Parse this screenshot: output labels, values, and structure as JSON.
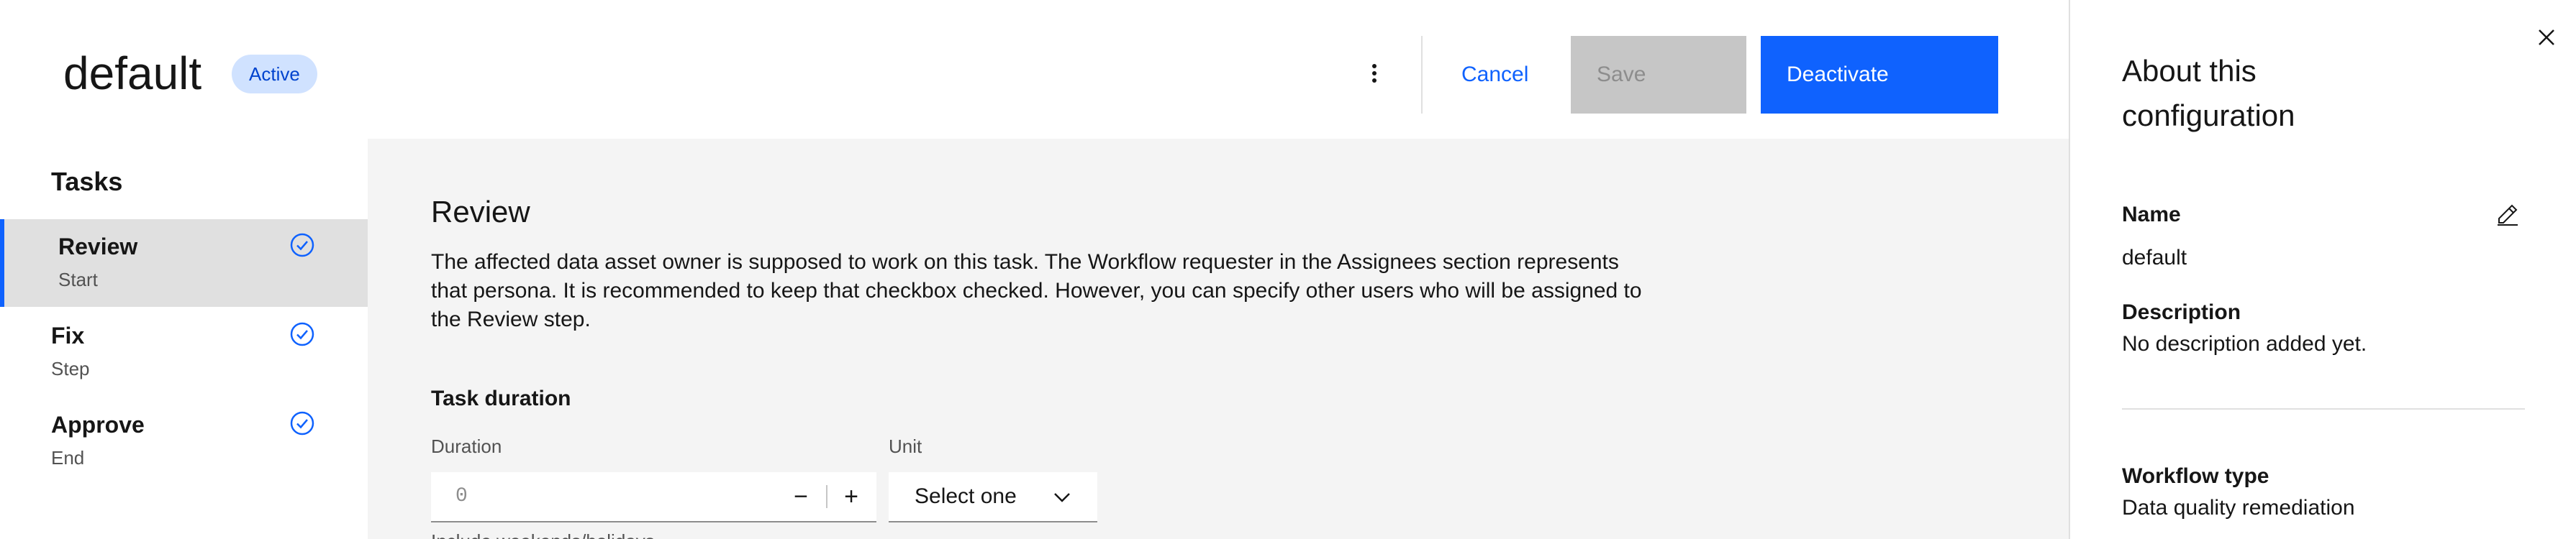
{
  "header": {
    "title": "default",
    "status_badge": "Active",
    "overflow_icon": "overflow-menu-vertical-icon",
    "cancel_label": "Cancel",
    "save_label": "Save",
    "deactivate_label": "Deactivate"
  },
  "sidebar": {
    "heading": "Tasks",
    "tasks": [
      {
        "name": "Review",
        "subtitle": "Start",
        "selected": true,
        "icon": "checkmark-outline-icon"
      },
      {
        "name": "Fix",
        "subtitle": "Step",
        "selected": false,
        "icon": "checkmark-outline-icon"
      },
      {
        "name": "Approve",
        "subtitle": "End",
        "selected": false,
        "icon": "checkmark-outline-icon"
      }
    ]
  },
  "main": {
    "section_title": "Review",
    "description": "The affected data asset owner is supposed to work on this task. The Workflow requester in the Assignees section represents that persona. It is recommended to keep that checkbox checked. However, you can specify other users who will be assigned to the Review step.",
    "task_duration_heading": "Task duration",
    "duration_label": "Duration",
    "duration_value": "0",
    "decrement_label": "−",
    "increment_label": "+",
    "unit_label": "Unit",
    "unit_placeholder": "Select one",
    "helper_text_partial": "Include weekends/holidays",
    "step_marker": "30"
  },
  "panel": {
    "title": "About this configuration",
    "name_label": "Name",
    "name_value": "default",
    "description_label": "Description",
    "description_value": "No description added yet.",
    "workflow_type_label": "Workflow type",
    "workflow_type_value": "Data quality remediation"
  },
  "colors": {
    "accent": "#0f62fe",
    "badge_bg": "#d0e2ff",
    "badge_text": "#0043ce",
    "disabled_bg": "#c6c6c6",
    "main_bg": "#f4f4f4",
    "selected_bg": "#e0e0e0"
  }
}
